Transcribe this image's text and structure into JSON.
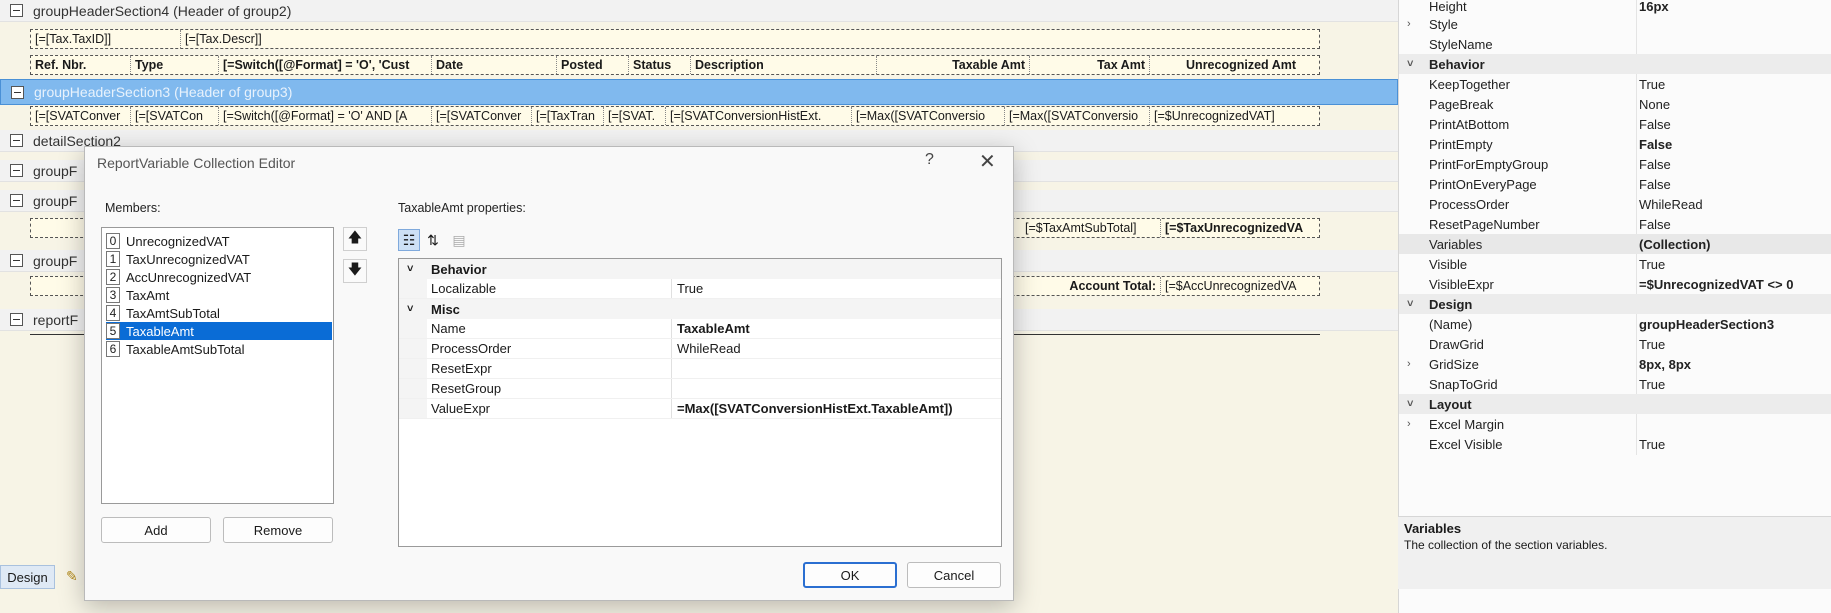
{
  "designer": {
    "sections": [
      {
        "title": "groupHeaderSection4 (Header of group2)"
      },
      {
        "title": "groupHeaderSection3 (Header of group3)"
      },
      {
        "title": "detailSection2"
      },
      {
        "title": "groupF"
      },
      {
        "title": "groupF"
      },
      {
        "title": "groupF"
      },
      {
        "title": "reportF"
      }
    ],
    "row1": [
      "[=[Tax.TaxID]]",
      "[=[Tax.Descr]]"
    ],
    "header_row": [
      "Ref. Nbr.",
      "Type",
      "[=Switch([@Format] = 'O', 'Cust",
      "Date",
      "Posted",
      "Status",
      "Description",
      "Taxable Amt",
      "Tax Amt",
      "Unrecognized Amt"
    ],
    "detail_row": [
      "[=[SVATConver",
      "[=[SVATCon",
      "[=Switch([@Format] = 'O' AND [A",
      "[=[SVATConver",
      "[=[TaxTran",
      "[=[SVAT.",
      "[=[SVATConversionHistExt.",
      "[=Max([SVATConversio",
      "[=Max([SVATConversio",
      "[=$UnrecognizedVAT]"
    ],
    "footer1": [
      "[=$TaxAmtSubTotal]",
      "[=$TaxUnrecognizedVA"
    ],
    "footer2": [
      "Account Total:",
      "[=$AccUnrecognizedVA"
    ],
    "tabs": {
      "design": "Design"
    }
  },
  "propgrid": {
    "rows": [
      {
        "name": "Height",
        "value": "16px",
        "bold": true
      },
      {
        "name": "Style",
        "value": "",
        "expand": true
      },
      {
        "name": "StyleName",
        "value": ""
      },
      {
        "name": "Behavior",
        "cat": true
      },
      {
        "name": "KeepTogether",
        "value": "True"
      },
      {
        "name": "PageBreak",
        "value": "None"
      },
      {
        "name": "PrintAtBottom",
        "value": "False"
      },
      {
        "name": "PrintEmpty",
        "value": "False",
        "bold": true
      },
      {
        "name": "PrintForEmptyGroup",
        "value": "False"
      },
      {
        "name": "PrintOnEveryPage",
        "value": "False"
      },
      {
        "name": "ProcessOrder",
        "value": "WhileRead"
      },
      {
        "name": "ResetPageNumber",
        "value": "False"
      },
      {
        "name": "Variables",
        "value": "(Collection)",
        "bold": true
      },
      {
        "name": "Visible",
        "value": "True"
      },
      {
        "name": "VisibleExpr",
        "value": "=$UnrecognizedVAT <> 0",
        "bold": true
      },
      {
        "name": "Design",
        "cat": true
      },
      {
        "name": "(Name)",
        "value": "groupHeaderSection3",
        "bold": true
      },
      {
        "name": "DrawGrid",
        "value": "True"
      },
      {
        "name": "GridSize",
        "value": "8px, 8px",
        "bold": true,
        "expand": true
      },
      {
        "name": "SnapToGrid",
        "value": "True"
      },
      {
        "name": "Layout",
        "cat": true
      },
      {
        "name": "Excel Margin",
        "value": "",
        "expand": true
      },
      {
        "name": "Excel Visible",
        "value": "True"
      }
    ],
    "help_title": "Variables",
    "help_desc": "The collection of the section variables."
  },
  "dialog": {
    "title": "ReportVariable Collection Editor",
    "help": "?",
    "close": "✕",
    "members_label": "Members:",
    "props_label": "TaxableAmt properties:",
    "members": [
      {
        "idx": "0",
        "name": "UnrecognizedVAT"
      },
      {
        "idx": "1",
        "name": "TaxUnrecognizedVAT"
      },
      {
        "idx": "2",
        "name": "AccUnrecognizedVAT"
      },
      {
        "idx": "3",
        "name": "TaxAmt"
      },
      {
        "idx": "4",
        "name": "TaxAmtSubTotal"
      },
      {
        "idx": "5",
        "name": "TaxableAmt"
      },
      {
        "idx": "6",
        "name": "TaxableAmtSubTotal"
      }
    ],
    "selected_index": 5,
    "grid": [
      {
        "name": "Behavior",
        "cat": true
      },
      {
        "name": "Localizable",
        "value": "True"
      },
      {
        "name": "Misc",
        "cat": true
      },
      {
        "name": "Name",
        "value": "TaxableAmt",
        "bold": true
      },
      {
        "name": "ProcessOrder",
        "value": "WhileRead"
      },
      {
        "name": "ResetExpr",
        "value": ""
      },
      {
        "name": "ResetGroup",
        "value": ""
      },
      {
        "name": "ValueExpr",
        "value": "=Max([SVATConversionHistExt.TaxableAmt])",
        "bold": true
      }
    ],
    "add": "Add",
    "remove": "Remove",
    "ok": "OK",
    "cancel": "Cancel"
  }
}
